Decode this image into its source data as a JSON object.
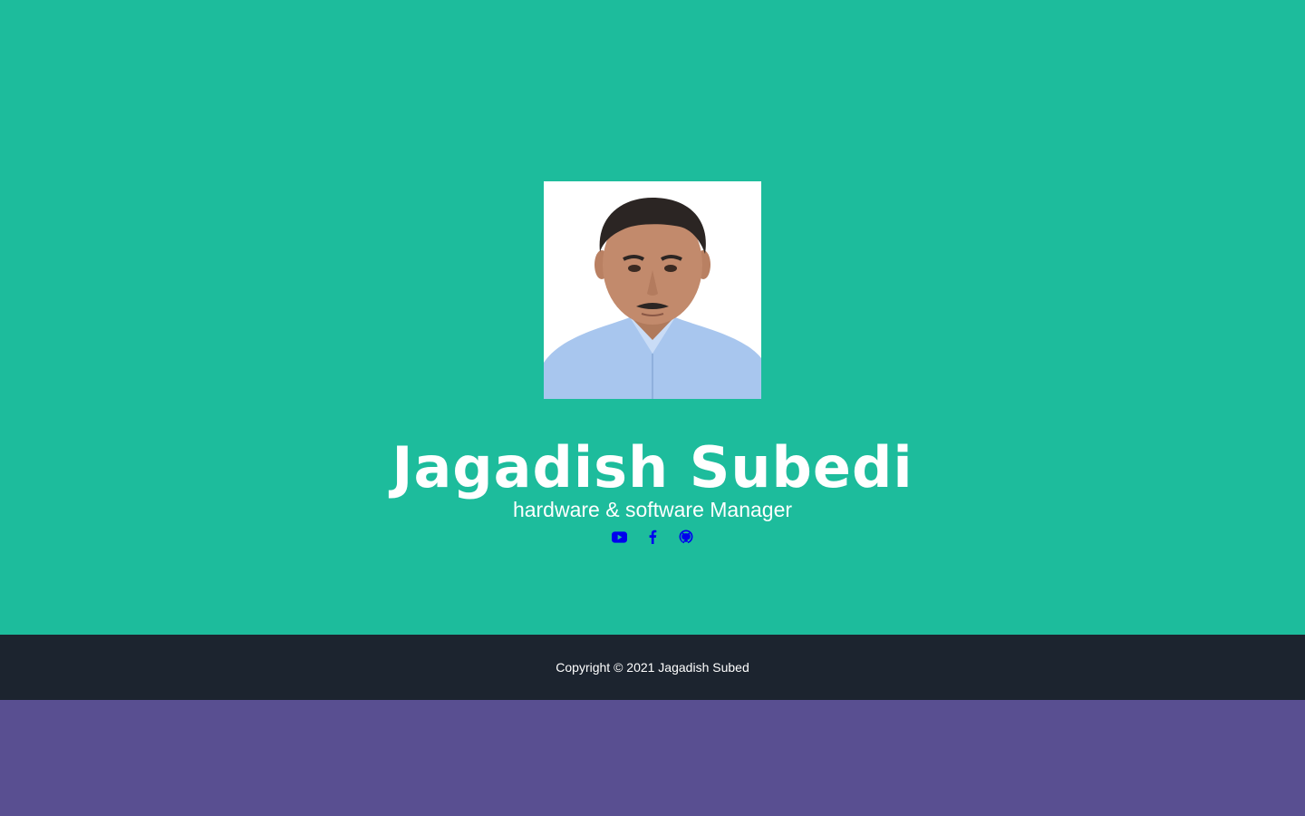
{
  "profile": {
    "name": "Jagadish Subedi",
    "title": "hardware & software Manager"
  },
  "social": {
    "links": [
      {
        "icon": "youtube-icon"
      },
      {
        "icon": "facebook-icon"
      },
      {
        "icon": "github-icon"
      }
    ],
    "link_color": "#0000ee"
  },
  "footer": {
    "copyright": "Copyright © 2021 Jagadish Subed"
  },
  "colors": {
    "masthead_bg": "#1dbc9c",
    "footer_bg": "#1c242f",
    "page_bg": "#594f91",
    "text": "#ffffff"
  }
}
